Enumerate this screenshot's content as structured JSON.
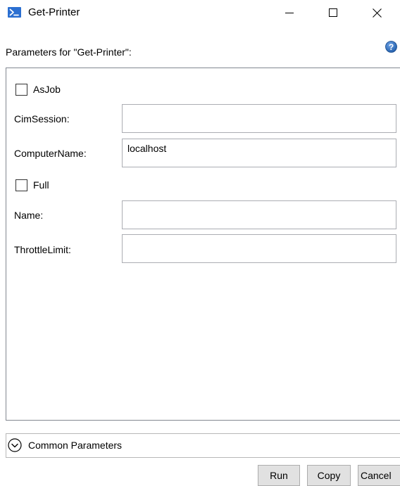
{
  "window": {
    "title": "Get-Printer",
    "icon": "powershell-icon"
  },
  "header": {
    "text": "Parameters for \"Get-Printer\":",
    "help_icon": "help-icon"
  },
  "parameters": {
    "asjob_label": "AsJob",
    "asjob_checked": false,
    "cimsession_label": "CimSession:",
    "cimsession_value": "",
    "computername_label": "ComputerName:",
    "computername_value": "localhost",
    "full_label": "Full",
    "full_checked": false,
    "name_label": "Name:",
    "name_value": "",
    "throttlelimit_label": "ThrottleLimit:",
    "throttlelimit_value": ""
  },
  "common": {
    "label": "Common Parameters",
    "expanded": false
  },
  "buttons": {
    "run": "Run",
    "copy": "Copy",
    "cancel": "Cancel"
  },
  "colors": {
    "powershell_icon": "#2b6fd1",
    "help_icon": "#1e5ba8",
    "button_face": "#e1e1e1"
  }
}
